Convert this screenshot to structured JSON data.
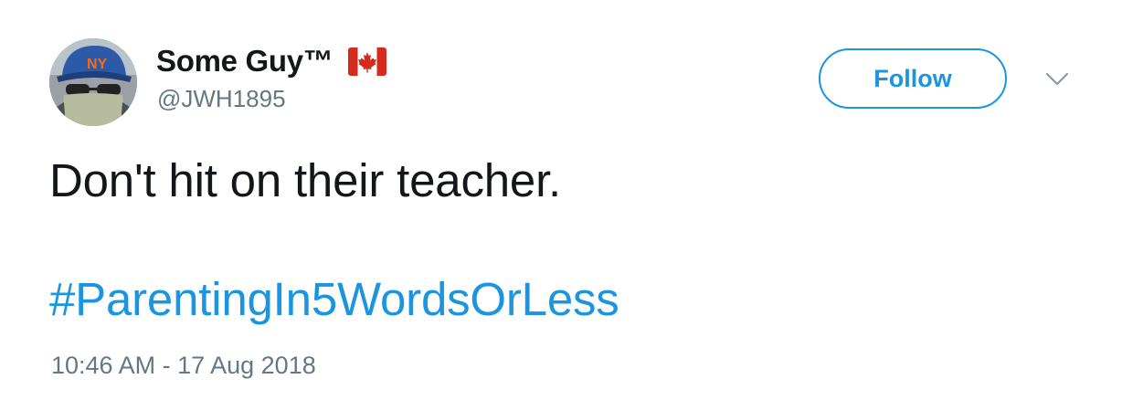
{
  "user": {
    "display_name": "Some Guy™",
    "flag_icon": "canada-flag-icon",
    "handle": "@JWH1895",
    "avatar_icon": "profile-photo-icon"
  },
  "follow_button": {
    "label": "Follow"
  },
  "menu": {
    "icon": "chevron-down-icon"
  },
  "tweet": {
    "text": "Don't hit on their teacher.",
    "hashtag": "#ParentingIn5WordsOrLess",
    "timestamp": "10:46 AM - 17 Aug 2018"
  },
  "colors": {
    "accent": "#1b95e0",
    "text_primary": "#14171a",
    "text_secondary": "#657786",
    "flag_red": "#d52b1e"
  }
}
